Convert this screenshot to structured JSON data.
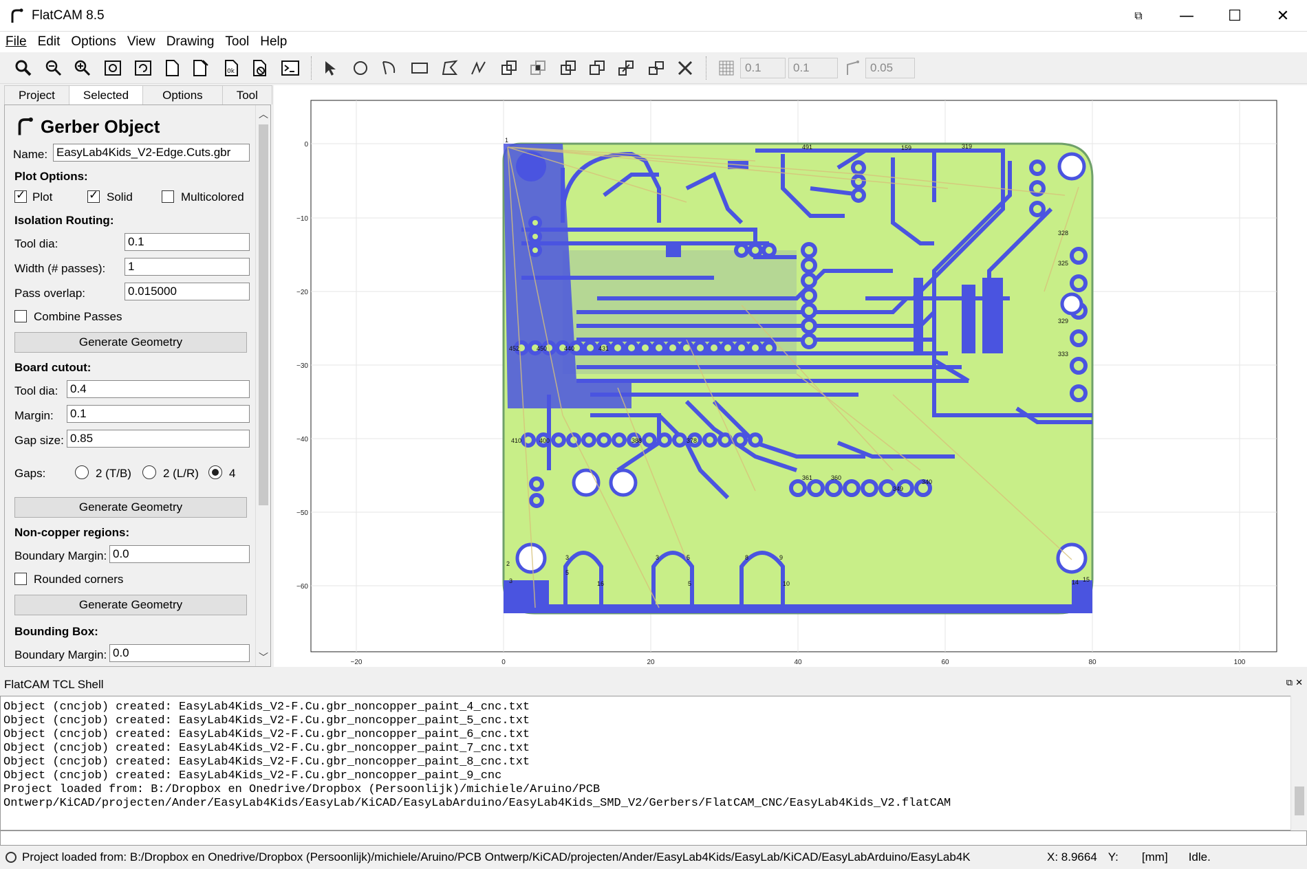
{
  "window": {
    "title": "FlatCAM 8.5"
  },
  "menu": {
    "items": [
      "File",
      "Edit",
      "Options",
      "View",
      "Drawing",
      "Tool",
      "Help"
    ]
  },
  "toolbar": {
    "grid_x": "0.1",
    "grid_y": "0.1",
    "snap_max": "0.05"
  },
  "tabs": [
    "Project",
    "Selected",
    "Options",
    "Tool"
  ],
  "panel": {
    "title": "Gerber Object",
    "name_label": "Name:",
    "name_value": "EasyLab4Kids_V2-Edge.Cuts.gbr",
    "plot_options": "Plot Options:",
    "plot": "Plot",
    "solid": "Solid",
    "multicolored": "Multicolored",
    "isolation": "Isolation Routing:",
    "tool_dia_label": "Tool dia:",
    "tool_dia_value": "0.1",
    "width_label": "Width (# passes):",
    "width_value": "1",
    "overlap_label": "Pass overlap:",
    "overlap_value": "0.015000",
    "combine": "Combine Passes",
    "generate": "Generate Geometry",
    "board_cutout": "Board cutout:",
    "cut_tool_dia_label": "Tool dia:",
    "cut_tool_dia_value": "0.4",
    "margin_label": "Margin:",
    "margin_value": "0.1",
    "gap_size_label": "Gap size:",
    "gap_size_value": "0.85",
    "gaps_label": "Gaps:",
    "gap_opt1": "2 (T/B)",
    "gap_opt2": "2 (L/R)",
    "gap_opt3": "4",
    "noncopper": "Non-copper regions:",
    "boundary_margin_label": "Boundary Margin:",
    "boundary_margin_value": "0.0",
    "rounded": "Rounded corners",
    "bbox": "Bounding Box:",
    "bbox_margin_label": "Boundary Margin:",
    "bbox_margin_value": "0.0"
  },
  "plot": {
    "y_ticks": [
      "0",
      "−10",
      "−20",
      "−30",
      "−40",
      "−50",
      "−60"
    ],
    "x_ticks": [
      "−20",
      "0",
      "20",
      "40",
      "60",
      "80",
      "100"
    ]
  },
  "shell": {
    "title": "FlatCAM TCL Shell",
    "lines": [
      "Object (cncjob) created: EasyLab4Kids_V2-F.Cu.gbr_noncopper_paint_4_cnc.txt",
      "Object (cncjob) created: EasyLab4Kids_V2-F.Cu.gbr_noncopper_paint_5_cnc.txt",
      "Object (cncjob) created: EasyLab4Kids_V2-F.Cu.gbr_noncopper_paint_6_cnc.txt",
      "Object (cncjob) created: EasyLab4Kids_V2-F.Cu.gbr_noncopper_paint_7_cnc.txt",
      "Object (cncjob) created: EasyLab4Kids_V2-F.Cu.gbr_noncopper_paint_8_cnc.txt",
      "Object (cncjob) created: EasyLab4Kids_V2-F.Cu.gbr_noncopper_paint_9_cnc",
      "Project loaded from: B:/Dropbox en Onedrive/Dropbox (Persoonlijk)/michiele/Aruino/PCB",
      "Ontwerp/KiCAD/projecten/Ander/EasyLab4Kids/EasyLab/KiCAD/EasyLabArduino/EasyLab4Kids_SMD_V2/Gerbers/FlatCAM_CNC/EasyLab4Kids_V2.flatCAM"
    ]
  },
  "status": {
    "message": "Project loaded from: B:/Dropbox en Onedrive/Dropbox (Persoonlijk)/michiele/Aruino/PCB Ontwerp/KiCAD/projecten/Ander/EasyLab4Kids/EasyLab/KiCAD/EasyLabArduino/EasyLab4K",
    "x": "X: 8.9664",
    "y": "Y:",
    "units": "[mm]",
    "state": "Idle."
  },
  "colors": {
    "board": "#c8ee88",
    "copper": "#4a54e0",
    "ratsnest": "#d8c27a"
  }
}
